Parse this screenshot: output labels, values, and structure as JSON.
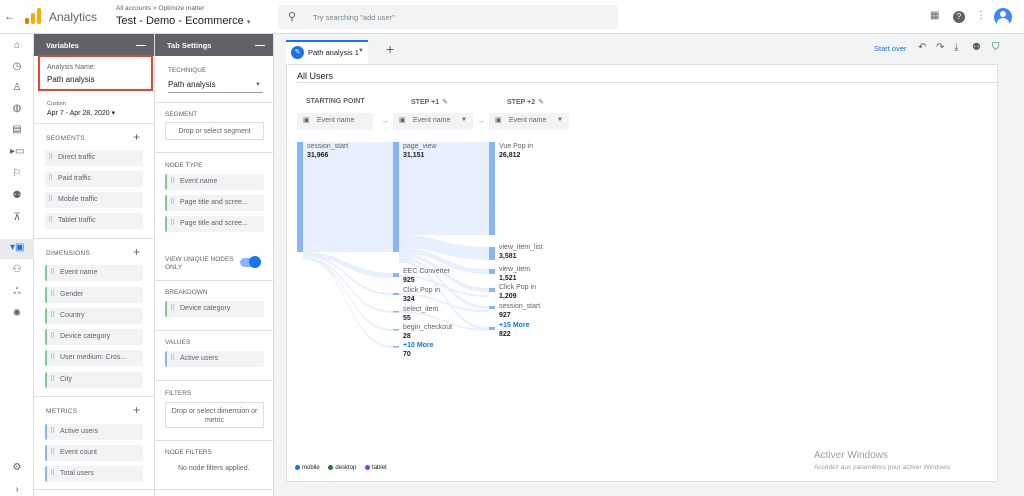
{
  "header": {
    "app_title": "Analytics",
    "breadcrumb": "All accounts > Optimize matter",
    "property": "Test - Demo - Ecommerce",
    "search_placeholder": "Try searching \"add user\""
  },
  "variables": {
    "title": "Variables",
    "analysis_name_label": "Analysis Name:",
    "analysis_name": "Path analysis",
    "date_label": "Custom",
    "date_range": "Apr 7 - Apr 28, 2020",
    "segments_label": "SEGMENTS",
    "segments": [
      "Direct traffic",
      "Paid traffic",
      "Mobile traffic",
      "Tablet traffic"
    ],
    "dimensions_label": "DIMENSIONS",
    "dimensions": [
      "Event name",
      "Gender",
      "Country",
      "Device category",
      "User medium: Cros...",
      "City"
    ],
    "metrics_label": "METRICS",
    "metrics": [
      "Active users",
      "Event count",
      "Total users"
    ]
  },
  "tab_settings": {
    "title": "Tab Settings",
    "technique_label": "TECHNIQUE",
    "technique": "Path analysis",
    "segment_label": "SEGMENT",
    "segment_drop": "Drop or select segment",
    "node_type_label": "NODE TYPE",
    "node_types": [
      "Event name",
      "Page title and scree...",
      "Page title and scree..."
    ],
    "unique_nodes_label_1": "VIEW UNIQUE NODES",
    "unique_nodes_label_2": "ONLY",
    "breakdown_label": "BREAKDOWN",
    "breakdown": "Device category",
    "values_label": "VALUES",
    "values": "Active users",
    "filters_label": "FILTERS",
    "filters_drop_1": "Drop or select dimension or",
    "filters_drop_2": "metric",
    "node_filters_label": "NODE FILTERS",
    "node_filters_text": "No node filters applied."
  },
  "canvas": {
    "tab_label": "Path analysis 1",
    "start_over": "Start over",
    "segment_title": "All Users",
    "columns": [
      "STARTING POINT",
      "STEP +1",
      "STEP +2"
    ],
    "selector_label": "Event name",
    "start_node": {
      "name": "session_start",
      "value": "31,966"
    },
    "step1_nodes": [
      {
        "name": "page_view",
        "value": "31,151"
      },
      {
        "name": "EEC Converter",
        "value": "925"
      },
      {
        "name": "Click Pop in",
        "value": "324"
      },
      {
        "name": "select_item",
        "value": "55"
      },
      {
        "name": "begin_checkout",
        "value": "28"
      }
    ],
    "step1_more": {
      "label": "+10 More",
      "value": "70"
    },
    "step2_nodes": [
      {
        "name": "Vue Pop in",
        "value": "26,812"
      },
      {
        "name": "view_item_list",
        "value": "3,581"
      },
      {
        "name": "view_item",
        "value": "1,521"
      },
      {
        "name": "Click Pop in",
        "value": "1,209"
      },
      {
        "name": "session_start",
        "value": "927"
      }
    ],
    "step2_more": {
      "label": "+15 More",
      "value": "822"
    },
    "legend": [
      {
        "label": "mobile",
        "color": "#1a73e8"
      },
      {
        "label": "desktop",
        "color": "#188038"
      },
      {
        "label": "tablet",
        "color": "#9334e6"
      }
    ]
  },
  "watermark": {
    "line1": "Activer Windows",
    "line2": "Accédez aux paramètres pour activer Windows."
  },
  "colors": {
    "accent": "#1a73e8",
    "highlight_border": "#e8452c",
    "node_bar": "#8ab4f8",
    "flow": "#e8f0fe"
  }
}
